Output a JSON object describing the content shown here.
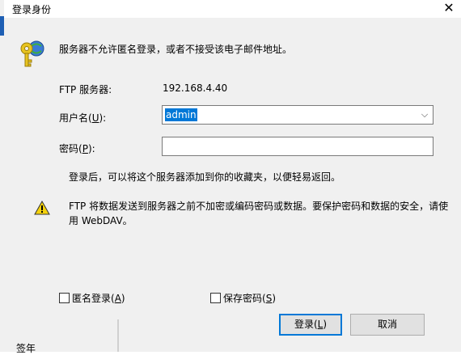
{
  "window": {
    "title": "登录身份",
    "close_glyph": "✕"
  },
  "intro_text": "服务器不允许匿名登录，或者不接受该电子邮件地址。",
  "server": {
    "label": "FTP 服务器:",
    "value": "192.168.4.40"
  },
  "username": {
    "label_prefix": "用户名(",
    "label_key": "U",
    "label_suffix": "):",
    "value": "admin",
    "dropdown_glyph": "⌵"
  },
  "password": {
    "label_prefix": "密码(",
    "label_key": "P",
    "label_suffix": "):",
    "value": ""
  },
  "hint_text": "登录后，可以将这个服务器添加到你的收藏夹，以便轻易返回。",
  "warning_text": "FTP 将数据发送到服务器之前不加密或编码密码或数据。要保护密码和数据的安全，请使用 WebDAV。",
  "anonymous": {
    "label_prefix": "匿名登录(",
    "label_key": "A",
    "label_suffix": ")",
    "checked": false
  },
  "save_password": {
    "label_prefix": "保存密码(",
    "label_key": "S",
    "label_suffix": ")",
    "checked": false
  },
  "buttons": {
    "login": {
      "prefix": "登录(",
      "key": "L",
      "suffix": ")"
    },
    "cancel": "取消"
  },
  "background_peek_text": "签年",
  "icons": [
    "key-globe-icon",
    "warning-icon",
    "close-icon",
    "chevron-down-icon"
  ],
  "colors": {
    "selection": "#0078d7",
    "default_button_border": "#0078d7",
    "dialog_bg": "#f0f0f0"
  }
}
